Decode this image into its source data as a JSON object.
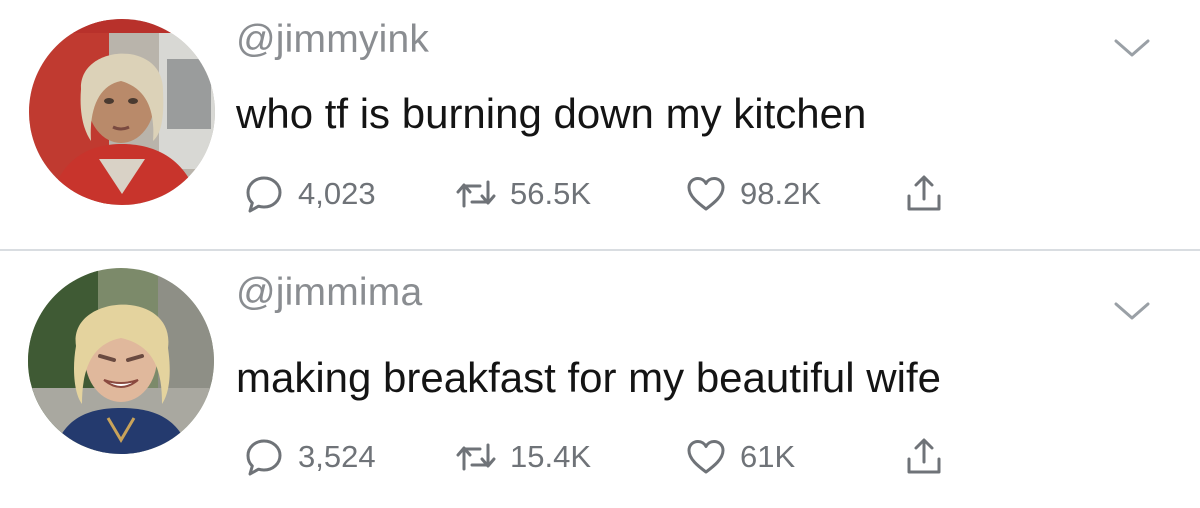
{
  "tweets": [
    {
      "handle": "@jimmyink",
      "text": "who tf is burning down my kitchen",
      "replies": "4,023",
      "retweets": "56.5K",
      "likes": "98.2K",
      "avatar_icon": "profile-photo"
    },
    {
      "handle": "@jimmima",
      "text": "making breakfast for my beautiful wife",
      "replies": "3,524",
      "retweets": "15.4K",
      "likes": "61K",
      "avatar_icon": "profile-photo"
    }
  ],
  "icons": {
    "reply": "speech-bubble-icon",
    "retweet": "retweet-arrows-icon",
    "like": "heart-icon",
    "share": "share-upload-icon",
    "menu": "chevron-down-icon"
  },
  "colors": {
    "handle": "#8a8d91",
    "text": "#141414",
    "icon": "#6f7378",
    "divider": "#d9dde1"
  }
}
